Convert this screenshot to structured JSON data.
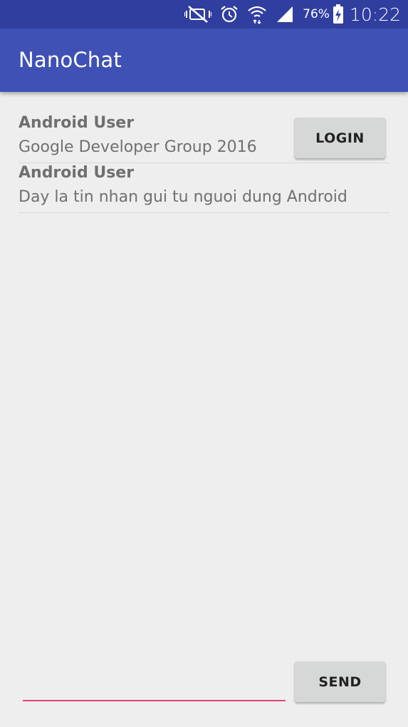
{
  "status_bar": {
    "battery_percent": "76%",
    "time": "10:22",
    "icons": [
      "vibrate-mute-icon",
      "alarm-icon",
      "wifi-icon",
      "signal-icon",
      "battery-charging-icon"
    ]
  },
  "app_bar": {
    "title": "NanoChat"
  },
  "login_button": {
    "label": "LOGIN"
  },
  "messages": [
    {
      "name": "Android User",
      "text": "Google Developer Group 2016"
    },
    {
      "name": "Android User",
      "text": "Day la tin nhan gui tu nguoi dung Android"
    }
  ],
  "composer": {
    "input_value": "",
    "input_placeholder": "",
    "send_label": "SEND"
  },
  "colors": {
    "status_bar": "#303f9f",
    "app_bar": "#3f51b5",
    "background": "#eeeeee",
    "accent": "#e0457b",
    "button": "#d6d7d7"
  }
}
